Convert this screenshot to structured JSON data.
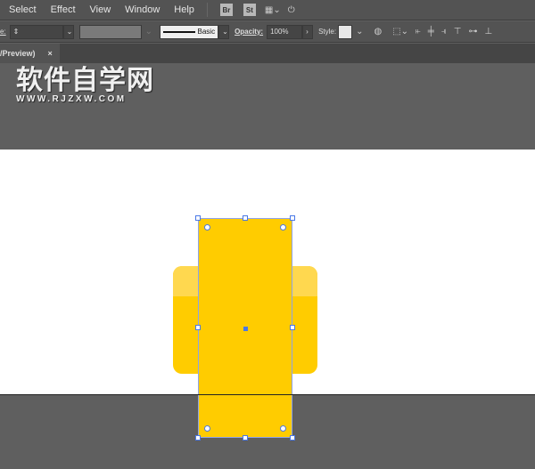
{
  "menu": [
    "Select",
    "Effect",
    "View",
    "Window",
    "Help"
  ],
  "apps": {
    "bridge": "Br",
    "stock": "St"
  },
  "control": {
    "prefix_label": "e:",
    "stroke_style": "Basic",
    "opacity_label": "Opacity:",
    "opacity_value": "100%",
    "style_label": "Style:"
  },
  "tab": {
    "label": "/Preview)",
    "close": "×"
  },
  "watermark": {
    "cn": "软件自学网",
    "en": "WWW.RJZXW.COM"
  },
  "colors": {
    "fill": "#ffcc00",
    "highlight": "#ffd84f",
    "selection": "#4a78e6"
  }
}
